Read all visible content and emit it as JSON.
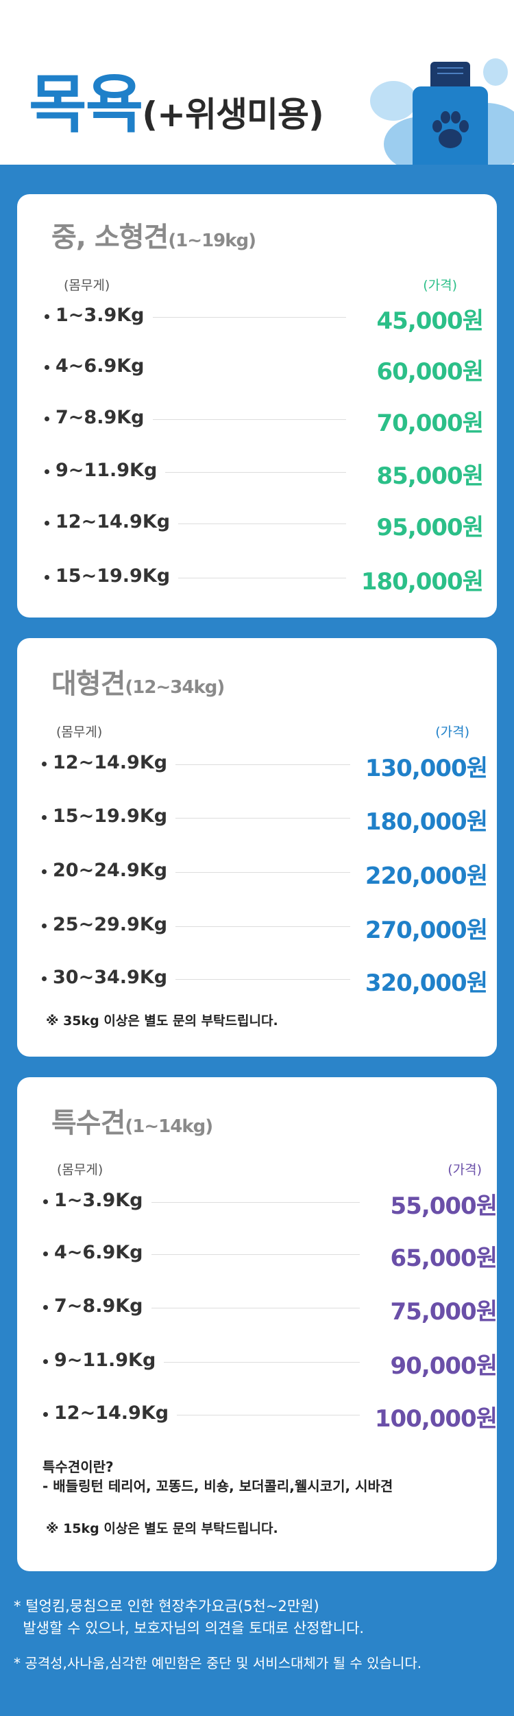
{
  "header": {
    "title_main": "목욕",
    "title_sub": "(+위생미용)"
  },
  "colors": {
    "green_price": "#2bbf88",
    "blue_price": "#1f80c9",
    "purple_price": "#6a4fa8",
    "background": "#2b84c9"
  },
  "small_medium": {
    "title": "중, 소형견",
    "range": "(1~19kg)",
    "weight_label": "(몸무게)",
    "price_label": "(가격)",
    "rows": [
      {
        "weight": "1~3.9Kg",
        "price": "45,000원"
      },
      {
        "weight": "4~6.9Kg",
        "price": "60,000원"
      },
      {
        "weight": "7~8.9Kg",
        "price": "70,000원"
      },
      {
        "weight": "9~11.9Kg",
        "price": "85,000원"
      },
      {
        "weight": "12~14.9Kg",
        "price": "95,000원"
      },
      {
        "weight": "15~19.9Kg",
        "price": "180,000원"
      }
    ]
  },
  "large": {
    "title": "대형견",
    "range": "(12~34kg)",
    "weight_label": "(몸무게)",
    "price_label": "(가격)",
    "rows": [
      {
        "weight": "12~14.9Kg",
        "price": "130,000원"
      },
      {
        "weight": "15~19.9Kg",
        "price": "180,000원"
      },
      {
        "weight": "20~24.9Kg",
        "price": "220,000원"
      },
      {
        "weight": "25~29.9Kg",
        "price": "270,000원"
      },
      {
        "weight": "30~34.9Kg",
        "price": "320,000원"
      }
    ],
    "note": "※ 35kg 이상은 별도 문의 부탁드립니다."
  },
  "special": {
    "title": "특수견",
    "range": "(1~14kg)",
    "weight_label": "(몸무게)",
    "price_label": "(가격)",
    "rows": [
      {
        "weight": "1~3.9Kg",
        "price": "55,000원"
      },
      {
        "weight": "4~6.9Kg",
        "price": "65,000원"
      },
      {
        "weight": "7~8.9Kg",
        "price": "75,000원"
      },
      {
        "weight": "9~11.9Kg",
        "price": "90,000원"
      },
      {
        "weight": "12~14.9Kg",
        "price": "100,000원"
      }
    ],
    "definition_title": "특수견이란?",
    "definition_text": "- 배들링턴 테리어, 꼬똥드, 비숑, 보더콜리,웰시코기, 시바견",
    "note": "※ 15kg 이상은 별도 문의 부탁드립니다."
  },
  "footer": {
    "line1": "* 털엉킴,뭉침으로 인한 현장추가요금(5천~2만원)",
    "line2": "  발생할 수 있으나, 보호자님의 의견을 토대로 산정합니다.",
    "line3": "* 공격성,사나움,심각한 예민함은 중단 및 서비스대체가 될 수 있습니다."
  }
}
